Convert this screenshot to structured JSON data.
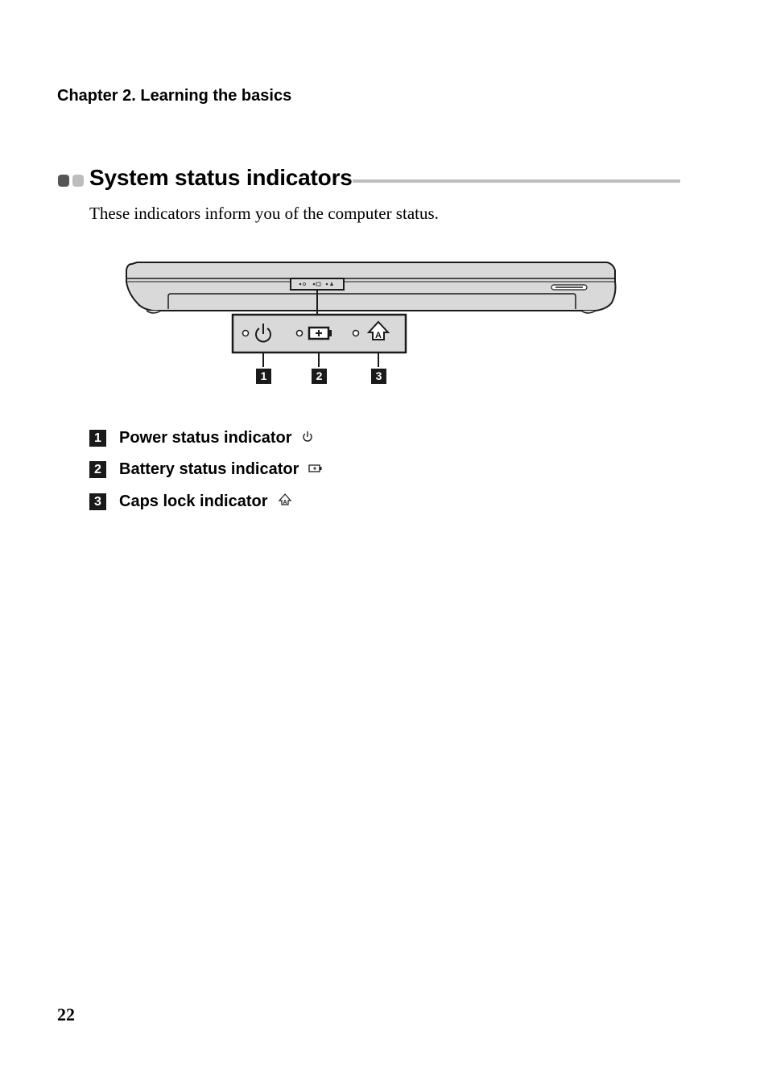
{
  "header": {
    "chapter": "Chapter 2. Learning the basics"
  },
  "section": {
    "title": "System status indicators",
    "intro": "These indicators inform you of the computer status."
  },
  "figure": {
    "callouts": [
      "1",
      "2",
      "3"
    ],
    "indicator_icons": [
      "power-icon",
      "battery-icon",
      "caps-lock-icon"
    ]
  },
  "items": [
    {
      "number": "1",
      "label": "Power status indicator",
      "icon": "power-icon"
    },
    {
      "number": "2",
      "label": "Battery status indicator",
      "icon": "battery-icon"
    },
    {
      "number": "3",
      "label": "Caps lock indicator",
      "icon": "caps-lock-icon"
    }
  ],
  "footer": {
    "page_number": "22"
  }
}
